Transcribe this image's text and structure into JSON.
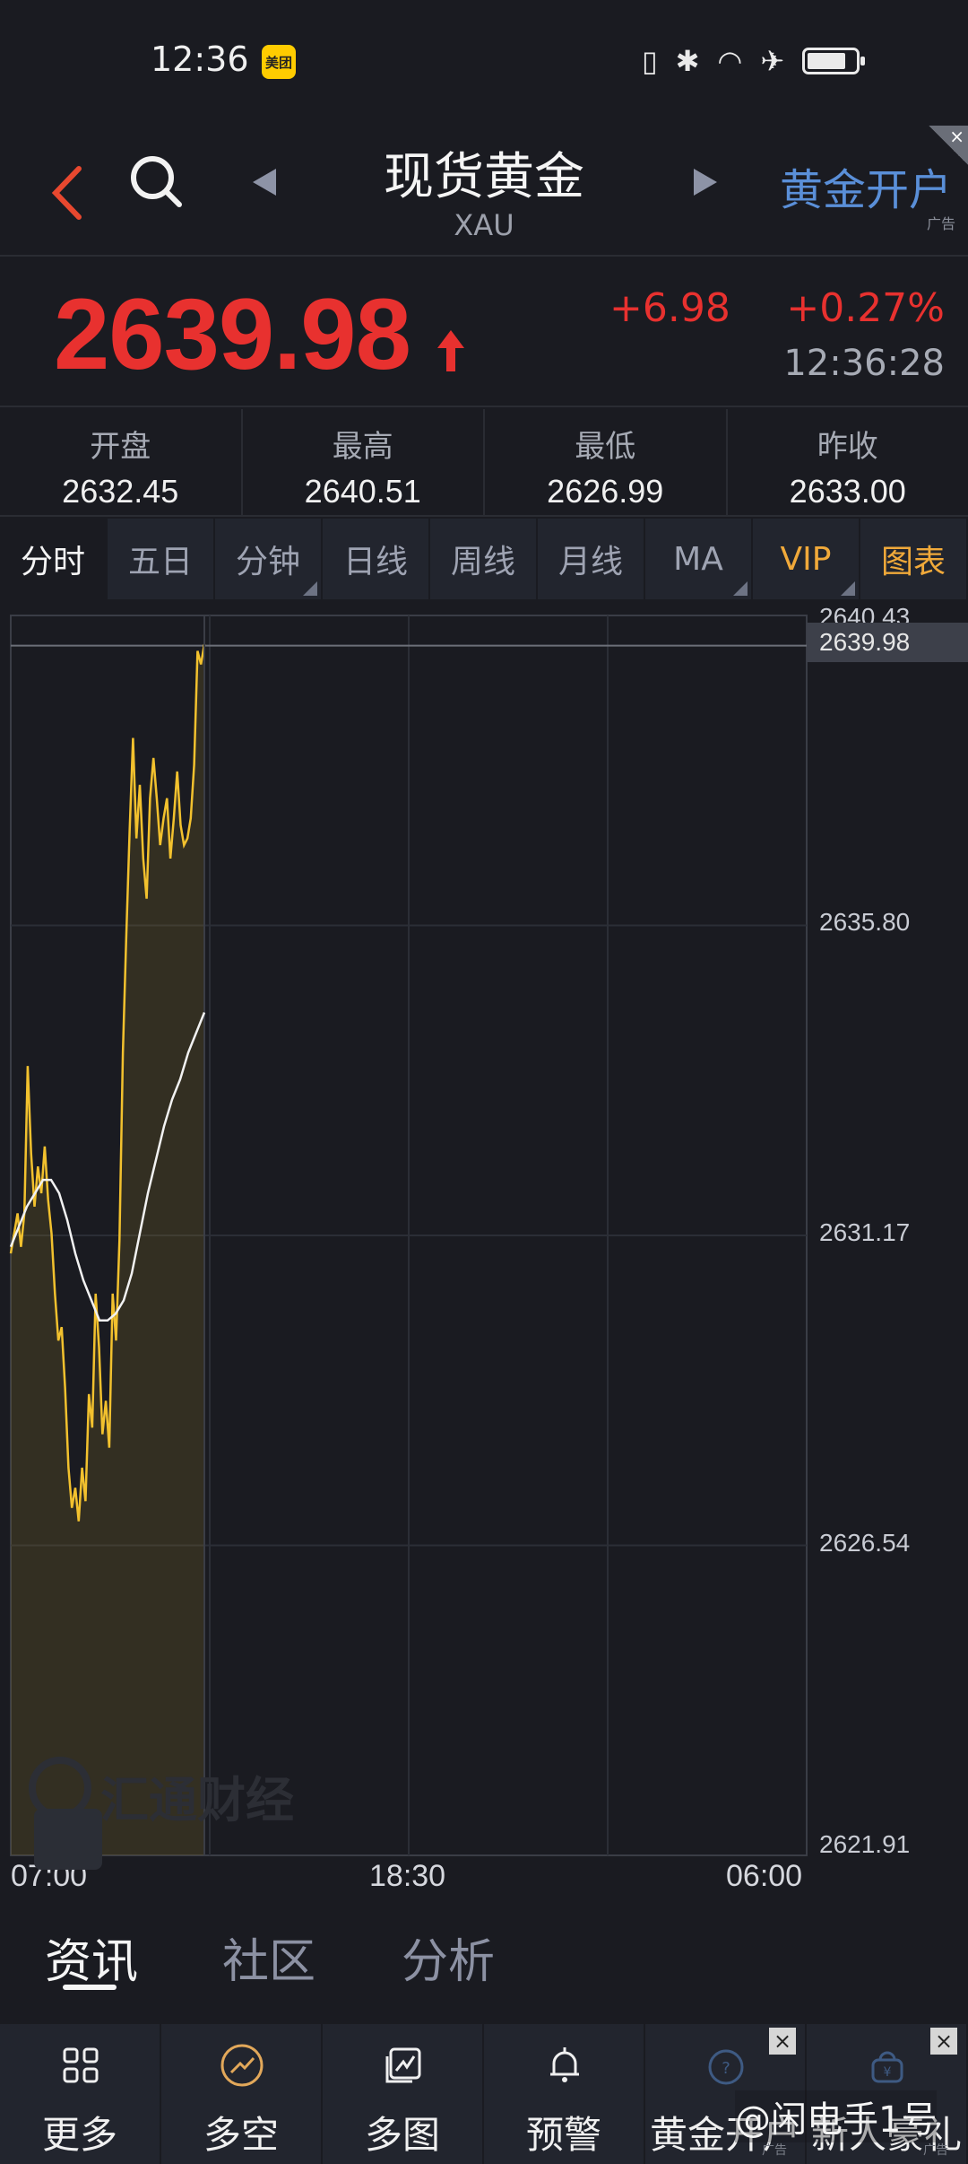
{
  "status_bar": {
    "time": "12:36",
    "app_badge": "美团"
  },
  "header": {
    "title": "现货黄金",
    "subtitle": "XAU",
    "ad_label": "黄金开户",
    "ad_tag": "广告",
    "ad_close": "×"
  },
  "quote": {
    "price": "2639.98",
    "change": "+6.98",
    "change_pct": "+0.27%",
    "time": "12:36:28",
    "direction": "up",
    "color_up": "#e8312f"
  },
  "stats": [
    {
      "label": "开盘",
      "value": "2632.45"
    },
    {
      "label": "最高",
      "value": "2640.51"
    },
    {
      "label": "最低",
      "value": "2626.99"
    },
    {
      "label": "昨收",
      "value": "2633.00"
    }
  ],
  "period_tabs": [
    "分时",
    "五日",
    "分钟",
    "日线",
    "周线",
    "月线",
    "MA",
    "VIP",
    "图表"
  ],
  "chart_data": {
    "type": "area",
    "title": "",
    "xlabel": "",
    "ylabel": "",
    "x_ticks": [
      "07:00",
      "18:30",
      "06:00"
    ],
    "y_ticks": [
      "2640.43",
      "2635.80",
      "2631.17",
      "2626.54",
      "2621.91"
    ],
    "ylim": [
      2621.91,
      2640.43
    ],
    "last_value_label": "2639.98",
    "grid": true,
    "series": [
      {
        "values": [
          2630.9,
          2631.2,
          2631.5,
          2631.0,
          2631.5,
          2633.7,
          2632.4,
          2631.6,
          2632.2,
          2631.8,
          2632.5,
          2631.7,
          2631.2,
          2630.3,
          2629.6,
          2629.8,
          2628.9,
          2627.7,
          2627.1,
          2627.4,
          2626.9,
          2627.7,
          2627.2,
          2628.8,
          2628.3,
          2630.3,
          2629.5,
          2628.2,
          2628.7,
          2628.0,
          2630.3,
          2629.6,
          2631.1,
          2633.9,
          2635.6,
          2637.2,
          2638.6,
          2637.1,
          2637.9,
          2636.8,
          2636.2,
          2637.7,
          2638.3,
          2637.7,
          2637.0,
          2637.4,
          2637.7,
          2636.8,
          2637.4,
          2638.1,
          2637.3,
          2637.0,
          2637.1,
          2637.4,
          2638.2,
          2639.9,
          2639.7,
          2640.0
        ]
      },
      {
        "values": [
          2631.0,
          2631.3,
          2631.6,
          2631.8,
          2632.0,
          2632.0,
          2631.8,
          2631.4,
          2630.9,
          2630.5,
          2630.2,
          2629.9,
          2629.9,
          2630.0,
          2630.2,
          2630.6,
          2631.2,
          2631.8,
          2632.3,
          2632.8,
          2633.2,
          2633.5,
          2633.9,
          2634.2,
          2634.5
        ]
      }
    ]
  },
  "watermark": "汇通财经",
  "news_tabs": [
    "资讯",
    "社区",
    "分析"
  ],
  "bottom_nav": [
    {
      "label": "更多",
      "icon": "grid-icon"
    },
    {
      "label": "多空",
      "icon": "trend-circle-icon"
    },
    {
      "label": "多图",
      "icon": "multi-chart-icon"
    },
    {
      "label": "预警",
      "icon": "bell-icon"
    },
    {
      "label": "黄金开户",
      "icon": "gold-account-icon",
      "ad_tag": "广告"
    },
    {
      "label": "新人豪礼",
      "icon": "gift-icon",
      "ad_tag": "广告"
    }
  ],
  "credit": "@闲电手1号"
}
